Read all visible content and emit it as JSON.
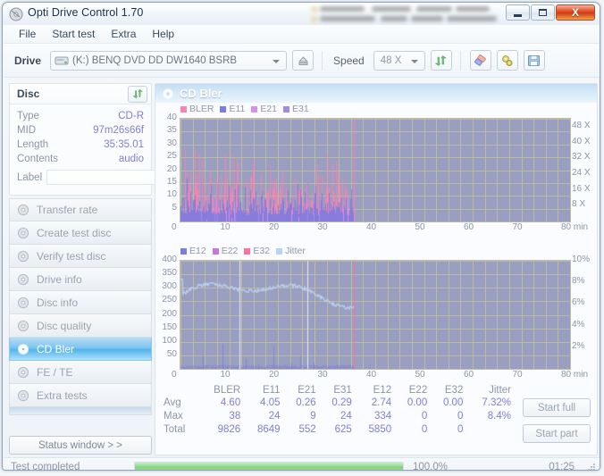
{
  "window": {
    "title": "Opti Drive Control 1.70",
    "icon": "disc-icon",
    "minimize_label": "Minimize",
    "maximize_label": "Maximize",
    "close_label": "X"
  },
  "menu": {
    "items": [
      {
        "label": "File",
        "name": "menu-file"
      },
      {
        "label": "Start test",
        "name": "menu-start-test"
      },
      {
        "label": "Extra",
        "name": "menu-extra"
      },
      {
        "label": "Help",
        "name": "menu-help"
      }
    ]
  },
  "toolbar": {
    "drive_label": "Drive",
    "drive_value": "(K:)   BENQ DVD DD DW1640 BSRB",
    "eject_icon": "eject-icon",
    "speed_label": "Speed",
    "speed_value": "48 X",
    "refresh_icon": "refresh-icon",
    "erase_icon": "eraser-icon",
    "settings_icon": "gears-icon",
    "save_icon": "floppy-save-icon"
  },
  "disc_panel": {
    "title": "Disc",
    "refresh_icon": "refresh-icon",
    "rows": [
      {
        "key": "Type",
        "value": "CD-R"
      },
      {
        "key": "MID",
        "value": "97m26s66f"
      },
      {
        "key": "Length",
        "value": "35:35.01"
      },
      {
        "key": "Contents",
        "value": "audio"
      }
    ],
    "label_key": "Label",
    "label_value": "",
    "label_placeholder": "",
    "cd_icon": "cd-disc-icon"
  },
  "nav": {
    "items": [
      {
        "label": "Transfer rate",
        "name": "sidebar-item-transfer-rate",
        "active": false
      },
      {
        "label": "Create test disc",
        "name": "sidebar-item-create-test-disc",
        "active": false
      },
      {
        "label": "Verify test disc",
        "name": "sidebar-item-verify-test-disc",
        "active": false
      },
      {
        "label": "Drive info",
        "name": "sidebar-item-drive-info",
        "active": false
      },
      {
        "label": "Disc info",
        "name": "sidebar-item-disc-info",
        "active": false
      },
      {
        "label": "Disc quality",
        "name": "sidebar-item-disc-quality",
        "active": false
      },
      {
        "label": "CD Bler",
        "name": "sidebar-item-cd-bler",
        "active": true
      },
      {
        "label": "FE / TE",
        "name": "sidebar-item-fe-te",
        "active": false
      },
      {
        "label": "Extra tests",
        "name": "sidebar-item-extra-tests",
        "active": false
      }
    ],
    "status_window_label": "Status window > >"
  },
  "content": {
    "title": "CD Bler",
    "icon": "disc-icon"
  },
  "buttons": {
    "start_full": "Start full",
    "start_part": "Start part"
  },
  "statusbar": {
    "message": "Test completed",
    "percent": "100.0%",
    "progress_value": 100,
    "time": "01:25"
  },
  "stats": {
    "columns": [
      "BLER",
      "E11",
      "E21",
      "E31",
      "E12",
      "E22",
      "E32",
      "Jitter"
    ],
    "rows": [
      {
        "label": "Avg",
        "values": [
          "4.60",
          "4.05",
          "0.26",
          "0.29",
          "2.74",
          "0.00",
          "0.00",
          "7.32%"
        ]
      },
      {
        "label": "Max",
        "values": [
          "38",
          "24",
          "9",
          "24",
          "334",
          "0",
          "0",
          "8.4%"
        ]
      },
      {
        "label": "Total",
        "values": [
          "9826",
          "8649",
          "552",
          "625",
          "5850",
          "0",
          "0",
          ""
        ]
      }
    ]
  },
  "colors": {
    "bler": "#ff80b0",
    "e11": "#7b7be0",
    "e21": "#d98fe8",
    "e31": "#a08ae8",
    "e12": "#7b7be0",
    "e22": "#c07ae0",
    "e32": "#ff6fa0",
    "jitter": "#bcd2f0",
    "plot_bg": "#9a9ec0",
    "grid": "#c0c09c",
    "accent": "#52b5ec",
    "progress": "#8fd98f",
    "value_text": "#7e7fd0"
  },
  "chart_data": [
    {
      "type": "line",
      "name": "cd-bler-error-chart",
      "title": "",
      "xlabel": "min",
      "ylabel": "",
      "xlim": [
        0,
        80
      ],
      "ylim": [
        0,
        40
      ],
      "xticks": [
        0,
        10,
        20,
        30,
        40,
        50,
        60,
        70,
        80
      ],
      "xticklabels": [
        "0",
        "10",
        "20",
        "30",
        "40",
        "50",
        "60",
        "70",
        "80 min"
      ],
      "yticks": [
        5,
        10,
        15,
        20,
        25,
        30,
        35,
        40
      ],
      "yticklabels": [
        "5",
        "10",
        "15",
        "20",
        "25",
        "30",
        "35",
        "40"
      ],
      "y2lim": [
        0,
        52
      ],
      "y2ticks": [
        8,
        16,
        24,
        32,
        40,
        48
      ],
      "y2ticklabels": [
        "8 X",
        "16 X",
        "24 X",
        "32 X",
        "40 X",
        "48 X"
      ],
      "grid": true,
      "legend": [
        {
          "label": "BLER",
          "color": "#ff80b0"
        },
        {
          "label": "E11",
          "color": "#7b7be0"
        },
        {
          "label": "E21",
          "color": "#d98fe8"
        },
        {
          "label": "E31",
          "color": "#a08ae8"
        }
      ],
      "data_end_min": 35.6,
      "series": [
        {
          "name": "BLER",
          "color": "#ff80b0",
          "avg": 4.6,
          "max": 38,
          "total": 9826
        },
        {
          "name": "E11",
          "color": "#7b7be0",
          "avg": 4.05,
          "max": 24,
          "total": 8649
        },
        {
          "name": "E21",
          "color": "#d98fe8",
          "avg": 0.26,
          "max": 9,
          "total": 552
        },
        {
          "name": "E31",
          "color": "#a08ae8",
          "avg": 0.29,
          "max": 24,
          "total": 625
        }
      ]
    },
    {
      "type": "line",
      "name": "cd-bler-e12-jitter-chart",
      "title": "",
      "xlabel": "min",
      "ylabel": "",
      "xlim": [
        0,
        80
      ],
      "ylim": [
        0,
        400
      ],
      "xticks": [
        0,
        10,
        20,
        30,
        40,
        50,
        60,
        70,
        80
      ],
      "xticklabels": [
        "0",
        "10",
        "20",
        "30",
        "40",
        "50",
        "60",
        "70",
        "80 min"
      ],
      "yticks": [
        50,
        100,
        150,
        200,
        250,
        300,
        350,
        400
      ],
      "yticklabels": [
        "50",
        "100",
        "150",
        "200",
        "250",
        "300",
        "350",
        "400"
      ],
      "y2lim": [
        0,
        10
      ],
      "y2ticks": [
        2,
        4,
        6,
        8,
        10
      ],
      "y2ticklabels": [
        "2%",
        "4%",
        "6%",
        "8%",
        "10%"
      ],
      "grid": true,
      "legend": [
        {
          "label": "E12",
          "color": "#7b7be0"
        },
        {
          "label": "E22",
          "color": "#c07ae0"
        },
        {
          "label": "E32",
          "color": "#ff6fa0"
        },
        {
          "label": "Jitter",
          "color": "#bcd2f0"
        }
      ],
      "data_end_min": 35.6,
      "series": [
        {
          "name": "E12",
          "color": "#7b7be0",
          "avg": 2.74,
          "max": 334,
          "total": 5850
        },
        {
          "name": "E22",
          "color": "#c07ae0",
          "avg": 0.0,
          "max": 0,
          "total": 0
        },
        {
          "name": "E32",
          "color": "#ff6fa0",
          "avg": 0.0,
          "max": 0,
          "total": 0
        },
        {
          "name": "Jitter",
          "color": "#bcd2f0",
          "avg": 7.32,
          "max": 8.4,
          "unit": "%"
        }
      ]
    }
  ]
}
